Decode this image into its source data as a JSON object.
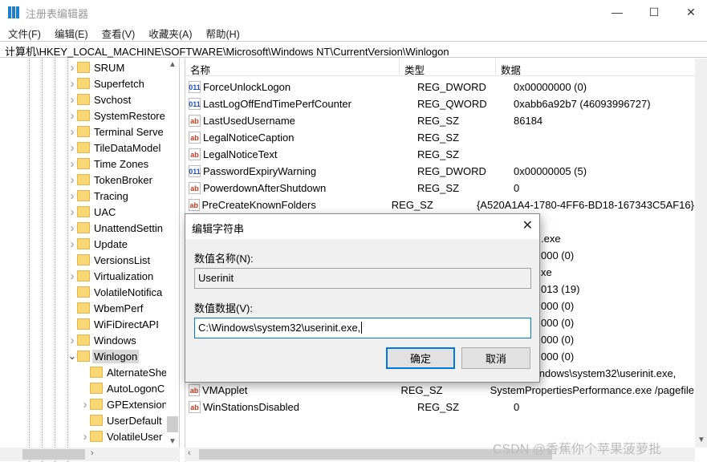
{
  "window": {
    "title": "注册表编辑器",
    "minimize": "—",
    "maximize": "☐",
    "close": "✕"
  },
  "menu": [
    "文件(F)",
    "编辑(E)",
    "查看(V)",
    "收藏夹(A)",
    "帮助(H)"
  ],
  "address": "计算机\\HKEY_LOCAL_MACHINE\\SOFTWARE\\Microsoft\\Windows NT\\CurrentVersion\\Winlogon",
  "tree": {
    "items": [
      {
        "label": "SRUM",
        "expandable": true
      },
      {
        "label": "Superfetch",
        "expandable": true
      },
      {
        "label": "Svchost",
        "expandable": true
      },
      {
        "label": "SystemRestore",
        "expandable": true
      },
      {
        "label": "Terminal Serve",
        "expandable": true
      },
      {
        "label": "TileDataModel",
        "expandable": true
      },
      {
        "label": "Time Zones",
        "expandable": true
      },
      {
        "label": "TokenBroker",
        "expandable": true
      },
      {
        "label": "Tracing",
        "expandable": true
      },
      {
        "label": "UAC",
        "expandable": true
      },
      {
        "label": "UnattendSettin",
        "expandable": true
      },
      {
        "label": "Update",
        "expandable": true
      },
      {
        "label": "VersionsList",
        "expandable": false
      },
      {
        "label": "Virtualization",
        "expandable": true
      },
      {
        "label": "VolatileNotifica",
        "expandable": false
      },
      {
        "label": "WbemPerf",
        "expandable": false
      },
      {
        "label": "WiFiDirectAPI",
        "expandable": false
      },
      {
        "label": "Windows",
        "expandable": true
      },
      {
        "label": "Winlogon",
        "expanded": true,
        "selected": true
      }
    ],
    "children": [
      {
        "label": "AlternateShe",
        "expandable": false
      },
      {
        "label": "AutoLogonC",
        "expandable": false
      },
      {
        "label": "GPExtension",
        "expandable": true
      },
      {
        "label": "UserDefault",
        "expandable": false
      },
      {
        "label": "VolatileUser",
        "expandable": true
      }
    ]
  },
  "list": {
    "headers": {
      "name": "名称",
      "type": "类型",
      "data": "数据"
    },
    "rows": [
      {
        "name": "ForceUnlockLogon",
        "type": "REG_DWORD",
        "data": "0x00000000 (0)",
        "icon": "dword"
      },
      {
        "name": "LastLogOffEndTimePerfCounter",
        "type": "REG_QWORD",
        "data": "0xabb6a92b7 (46093996727)",
        "icon": "dword"
      },
      {
        "name": "LastUsedUsername",
        "type": "REG_SZ",
        "data": "86184",
        "icon": "sz"
      },
      {
        "name": "LegalNoticeCaption",
        "type": "REG_SZ",
        "data": "",
        "icon": "sz"
      },
      {
        "name": "LegalNoticeText",
        "type": "REG_SZ",
        "data": "",
        "icon": "sz"
      },
      {
        "name": "PasswordExpiryWarning",
        "type": "REG_DWORD",
        "data": "0x00000005 (5)",
        "icon": "dword"
      },
      {
        "name": "PowerdownAfterShutdown",
        "type": "REG_SZ",
        "data": "0",
        "icon": "sz"
      },
      {
        "name": "PreCreateKnownFolders",
        "type": "REG_SZ",
        "data": "{A520A1A4-1780-4FF6-BD18-167343C5AF16}",
        "icon": "sz"
      }
    ],
    "obscured_fragments": [
      "",
      ".exe",
      "000 (0)",
      "xe",
      "013 (19)",
      "000 (0)",
      "000 (0)",
      "000 (0)",
      "000 (0)"
    ],
    "rows_after": [
      {
        "name": "Userinit",
        "type": "REG_SZ",
        "data": "C:\\Windows\\system32\\userinit.exe,",
        "icon": "sz"
      },
      {
        "name": "VMApplet",
        "type": "REG_SZ",
        "data": "SystemPropertiesPerformance.exe /pagefile",
        "icon": "sz"
      },
      {
        "name": "WinStationsDisabled",
        "type": "REG_SZ",
        "data": "0",
        "icon": "sz"
      }
    ]
  },
  "dialog": {
    "title": "编辑字符串",
    "name_label": "数值名称(N):",
    "name_value": "Userinit",
    "data_label": "数值数据(V):",
    "data_value": "C:\\Windows\\system32\\userinit.exe,",
    "ok": "确定",
    "cancel": "取消",
    "close": "✕"
  },
  "icons": {
    "sz": "ab",
    "dword": "011"
  },
  "colors": {
    "accent": "#0078d7",
    "folder": "#f8d775"
  },
  "watermark": "CSDN @香蕉你个苹果菠萝批"
}
